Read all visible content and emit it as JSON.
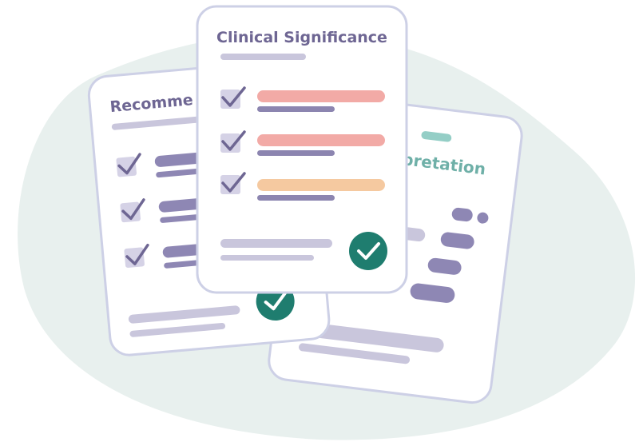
{
  "cards": {
    "left": {
      "title": "Recomme"
    },
    "right": {
      "title": "rpretation"
    },
    "center": {
      "title": "Clinical Significance"
    }
  },
  "colors": {
    "blob": "#e8f0ee",
    "card_bg": "#ffffff",
    "card_border": "#cdd0e6",
    "title_purple": "#6e6693",
    "title_teal": "#6fb0a8",
    "bar_grey": "#c9c6dc",
    "bar_purple_light": "#c3bedb",
    "bar_purple": "#8e87b4",
    "bar_dark_purple": "#8c85b0",
    "bar_red": "#f2aaa6",
    "bar_orange": "#f5c9a0",
    "check_box": "#d5d2e6",
    "check_mark": "#6e6693",
    "badge_green": "#1f7d6f",
    "teal_accent": "#94cec6"
  },
  "icons": [
    "check-icon",
    "check-circle-icon"
  ]
}
